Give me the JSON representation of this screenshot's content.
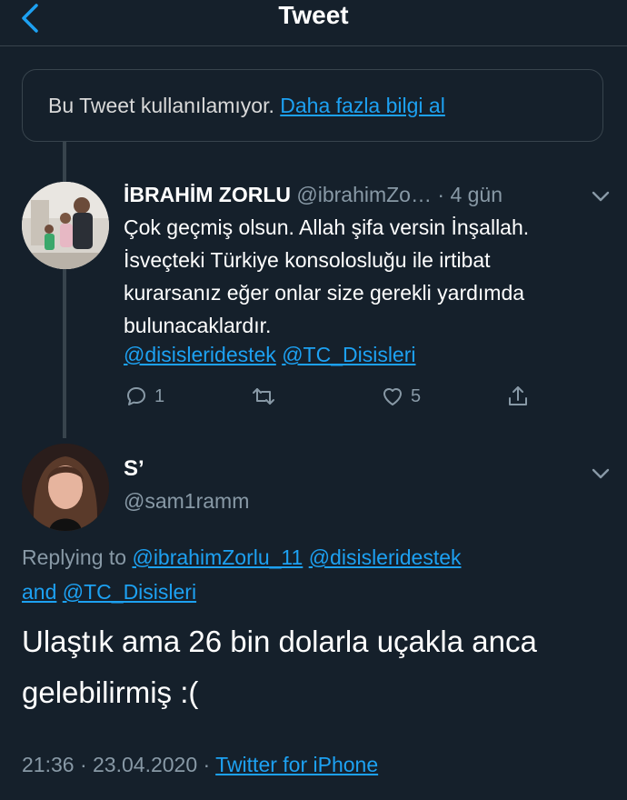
{
  "header": {
    "title": "Tweet"
  },
  "notice": {
    "text": "Bu Tweet kullanılamıyor. ",
    "link": "Daha fazla bilgi al"
  },
  "reply_tweet": {
    "name": "İBRAHİM ZORLU",
    "handle": "@ibrahimZo…",
    "sep": " · ",
    "time": "4 gün",
    "text": "Çok geçmiş olsun. Allah şifa versin İnşallah. İsveçteki Türkiye konsolosluğu ile irtibat kurarsanız eğer onlar size gerekli yardımda bulunacaklardır.",
    "mention1": "@disisleridestek",
    "mention2": "@TC_Disisleri",
    "reply_count": "1",
    "retweet_count": "",
    "like_count": "5"
  },
  "main_tweet": {
    "name": "S’",
    "handle": "@sam1ramm",
    "replying_prefix": "Replying to ",
    "replying_user1": "@ibrahimZorlu_11",
    "replying_user2": "@disisleridestek",
    "replying_and": "and",
    "replying_user3": "@TC_Disisleri",
    "text": "Ulaştık ama 26 bin dolarla uçakla anca gelebilirmiş :(",
    "time": "21:36",
    "sep": " · ",
    "date": "23.04.2020",
    "source": "Twitter for iPhone"
  },
  "colors": {
    "background": "#15202b",
    "accent": "#1da1f2",
    "secondary_text": "#8899a6",
    "border": "#38444d"
  }
}
